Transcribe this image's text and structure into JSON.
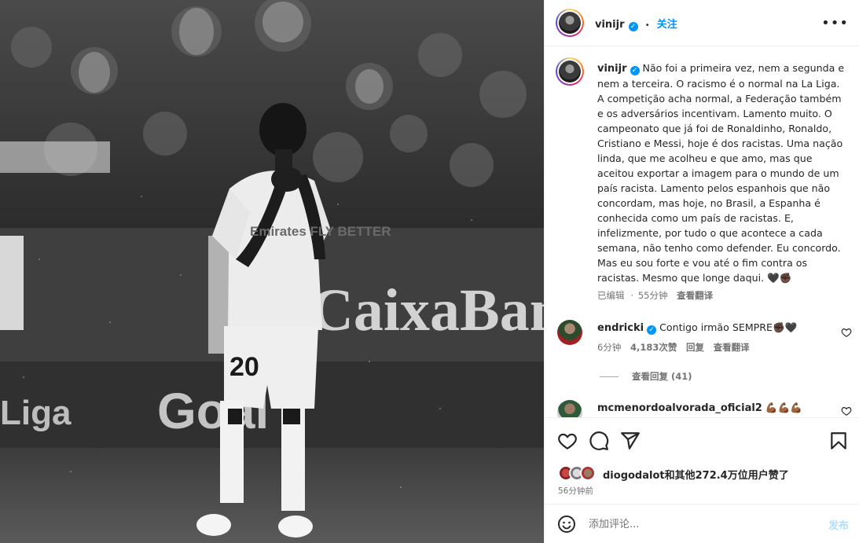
{
  "colors": {
    "link_blue": "#0095f6",
    "text": "#262626",
    "secondary": "#737373",
    "post_disabled": "#b2dffc"
  },
  "photo": {
    "banner_text": "CaixaBank",
    "jersey_number": "20",
    "jersey_sponsor": "Emirates FLY BETTER",
    "left_banner_text": "Liga",
    "lower_banner_text": "Goal"
  },
  "header": {
    "username": "vinijr",
    "verified_icon": "verified-badge-icon",
    "separator": "•",
    "follow_label": "关注",
    "more_icon": "more-options-icon"
  },
  "caption": {
    "username": "vinijr",
    "text": "Não foi a primeira vez, nem a segunda e nem a terceira. O racismo é o normal na La Liga. A competição acha normal, a Federação também e os adversários incentivam. Lamento muito. O campeonato que já foi de Ronaldinho, Ronaldo, Cristiano e Messi, hoje é dos racistas. Uma nação linda, que me acolheu e que amo, mas que aceitou exportar a imagem para o mundo de um país racista. Lamento pelos espanhois que não concordam, mas hoje, no Brasil, a Espanha é conhecida como um país de racistas. E, infelizmente, por tudo o que acontece a cada semana, não tenho como defender. Eu concordo. Mas eu sou forte e vou até o fim contra os racistas. Mesmo que longe daqui. 🖤✊🏿",
    "edited": "已编辑",
    "time": "55分钟",
    "translate": "查看翻译"
  },
  "comments": [
    {
      "username": "endricki",
      "text": "Contigo irmão SEMPRE✊🏿🖤",
      "time": "6分钟",
      "likes": "4,183次赞",
      "reply": "回复",
      "translate": "查看翻译",
      "view_replies": "查看回复 (41)"
    },
    {
      "username": "mcmenordoalvorada_oficial2",
      "text": "💪🏾💪🏾💪🏾"
    }
  ],
  "actions": {
    "like_icon": "heart-icon",
    "comment_icon": "comment-icon",
    "share_icon": "share-icon",
    "save_icon": "bookmark-icon"
  },
  "likes": {
    "text": "diogodalot和其他272.4万位用户赞了",
    "time": "56分钟前"
  },
  "add_comment": {
    "emoji_icon": "emoji-icon",
    "placeholder": "添加评论...",
    "post_label": "发布"
  }
}
